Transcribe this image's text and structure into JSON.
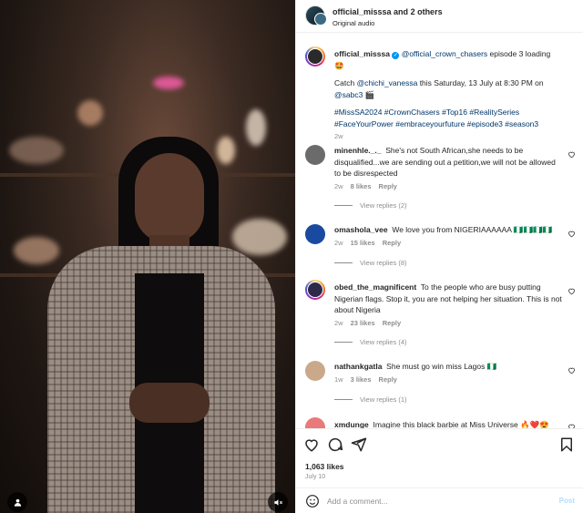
{
  "header": {
    "title_user": "official_misssa",
    "title_rest": " and ",
    "title_others": "2 others",
    "subtitle": "Original audio"
  },
  "caption": {
    "username": "official_misssa",
    "verified_badge": "✓",
    "mention": "@official_crown_chasers",
    "text1": " episode 3 loading 🤩",
    "line2a": "Catch ",
    "line2_mention": "@chichi_vanessa",
    "line2b": " this Saturday, 13 July at 8:30 PM on",
    "line3_mention": "@sabc3",
    "line3b": " 🎬",
    "hashtags1": "#MissSA2024 #CrownChasers #Top16 #RealitySeries",
    "hashtags2": "#FaceYourPower #embraceyourfuture #episode3 #season3",
    "time": "2w"
  },
  "comments": [
    {
      "username": "minenhle._._",
      "text": "She's not South African,she needs to be disqualified...we are sending out a petition,we will not be allowed to be disrespected",
      "time": "2w",
      "likes": "8 likes",
      "reply": "Reply",
      "view_replies": "View replies (2)",
      "avatar_color": "#6b6b6b"
    },
    {
      "username": "omashola_vee",
      "text": "We love you from NIGERIAAAAAA 🇳🇬🇳🇬🇳🇬🇳🇬",
      "time": "2w",
      "likes": "15 likes",
      "reply": "Reply",
      "view_replies": "View replies (8)",
      "avatar_color": "#1a4aa0"
    },
    {
      "username": "obed_the_magnificent",
      "text": "To the people who are busy putting Nigerian flags. Stop it, you are not helping her situation. This is not about Nigeria",
      "time": "2w",
      "likes": "23 likes",
      "reply": "Reply",
      "view_replies": "View replies (4)",
      "avatar_color": "#2c2a4a"
    },
    {
      "username": "nathankgatla",
      "text": "She must go win miss Lagos 🇳🇬",
      "time": "1w",
      "likes": "3 likes",
      "reply": "Reply",
      "view_replies": "View replies (1)",
      "avatar_color": "#c9a98a"
    },
    {
      "username": "xmdunge",
      "text": "Imagine this black barbie at Miss Universe 🔥❤️😍",
      "avatar_color": "#e87a7a"
    }
  ],
  "actions": {
    "likes": "1,063 likes",
    "date": "July 10"
  },
  "add_comment": {
    "placeholder": "Add a comment...",
    "post_label": "Post"
  },
  "icons": {
    "like": "heart-icon",
    "comment": "comment-icon",
    "share": "share-icon",
    "save": "bookmark-icon",
    "emoji": "emoji-icon",
    "mute": "muted-speaker-icon",
    "tags": "user-tag-icon"
  }
}
